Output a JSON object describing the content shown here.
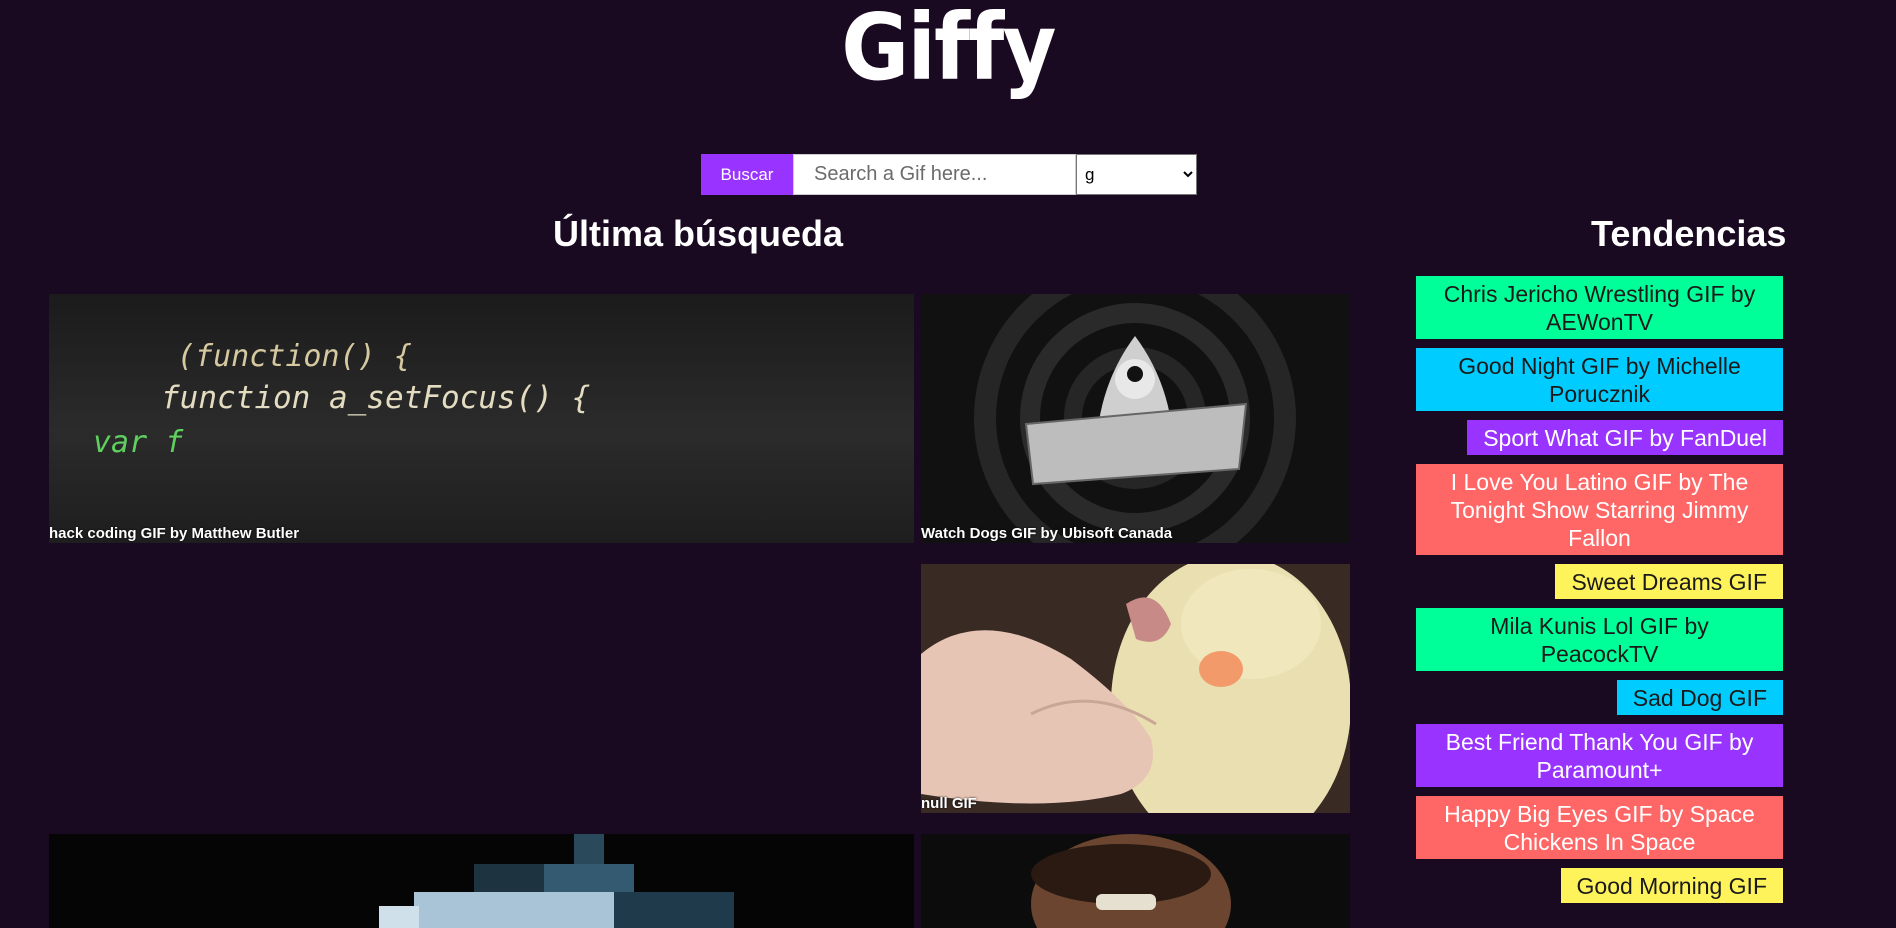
{
  "header": {
    "logo": "Giffy"
  },
  "search": {
    "button_label": "Buscar",
    "placeholder": "Search a Gif here...",
    "rating_selected": "g"
  },
  "sections": {
    "last_search_title": "Última búsqueda",
    "trends_title": "Tendencias"
  },
  "gifs": [
    {
      "title": "hack coding GIF by Matthew Butler",
      "code_lines": [
        "(function() {",
        "function a_setFocus() {",
        "var f"
      ]
    },
    {
      "title": "Watch Dogs GIF by Ubisoft Canada"
    },
    {
      "title": "null GIF"
    },
    {
      "title": ""
    },
    {
      "title": ""
    }
  ],
  "trends": [
    {
      "label": "Chris Jericho Wrestling GIF by AEWonTV",
      "color": "#00ff99"
    },
    {
      "label": "Good Night GIF by Michelle Porucznik",
      "color": "#00ccff"
    },
    {
      "label": "Sport What GIF by FanDuel",
      "color": "#9933ff"
    },
    {
      "label": "I Love You Latino GIF by The Tonight Show Starring Jimmy Fallon",
      "color": "#ff6666"
    },
    {
      "label": "Sweet Dreams GIF",
      "color": "#fff35c"
    },
    {
      "label": "Mila Kunis Lol GIF by PeacockTV",
      "color": "#00ff99"
    },
    {
      "label": "Sad Dog GIF",
      "color": "#00ccff"
    },
    {
      "label": "Best Friend Thank You GIF by Paramount+",
      "color": "#9933ff"
    },
    {
      "label": "Happy Big Eyes GIF by Space Chickens In Space",
      "color": "#ff6666"
    },
    {
      "label": "Good Morning GIF",
      "color": "#fff35c"
    }
  ]
}
